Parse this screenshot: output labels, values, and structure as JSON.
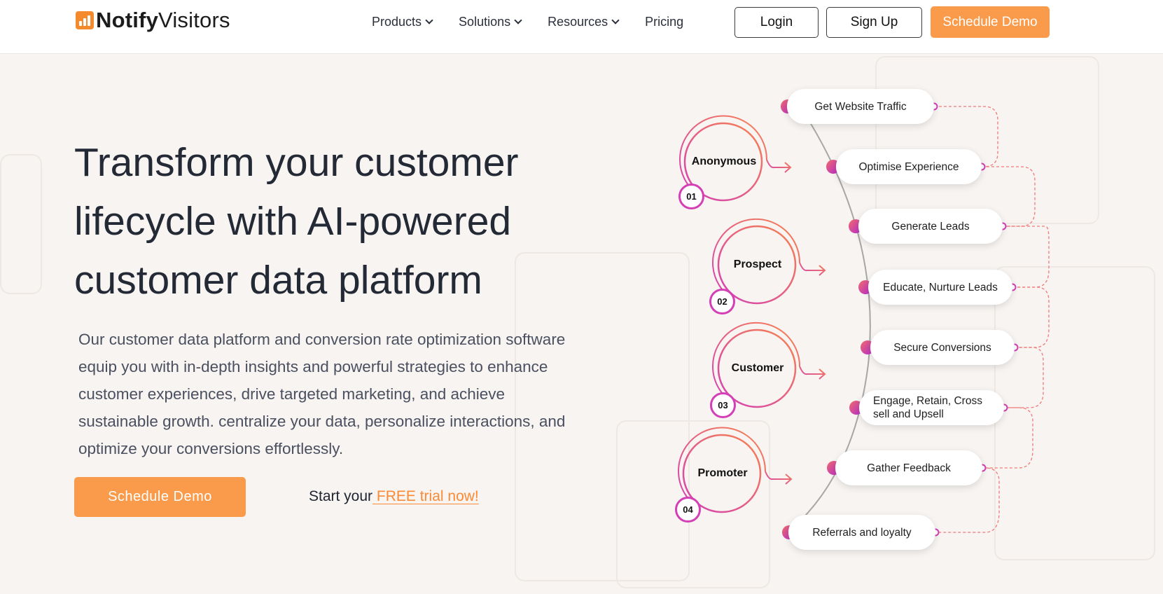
{
  "header": {
    "logo_bold": "Notify",
    "logo_regular": "Visitors",
    "nav": [
      {
        "label": "Products",
        "has_dropdown": true
      },
      {
        "label": "Solutions",
        "has_dropdown": true
      },
      {
        "label": "Resources",
        "has_dropdown": true
      },
      {
        "label": "Pricing",
        "has_dropdown": false
      }
    ],
    "login_label": "Login",
    "signup_label": "Sign Up",
    "demo_label": "Schedule Demo"
  },
  "hero": {
    "title_line1": "Transform your customer",
    "title_line2": "lifecycle with AI-powered",
    "title_line3": "customer data platform",
    "description": "Our customer data platform and conversion rate optimization software equip you with in-depth insights and powerful strategies to enhance customer experiences, drive targeted marketing, and achieve sustainable growth. centralize your data, personalize interactions, and optimize your conversions effortlessly.",
    "cta_label": "Schedule Demo",
    "trial_prefix": "Start your",
    "trial_link": " FREE trial now!"
  },
  "diagram": {
    "stages": [
      {
        "label": "Anonymous",
        "number": "01"
      },
      {
        "label": "Prospect",
        "number": "02"
      },
      {
        "label": "Customer",
        "number": "03"
      },
      {
        "label": "Promoter",
        "number": "04"
      }
    ],
    "steps": [
      "Get Website Traffic",
      "Optimise Experience",
      "Generate Leads",
      "Educate, Nurture Leads",
      "Secure Conversions",
      "Engage, Retain, Cross sell and Upsell",
      "Gather Feedback",
      "Referrals and loyalty"
    ]
  },
  "colors": {
    "brand_orange": "#fa9a4b",
    "gradient_pink": "#d43fb6",
    "gradient_orange": "#f7834e",
    "page_bg": "#f7f4f1"
  }
}
